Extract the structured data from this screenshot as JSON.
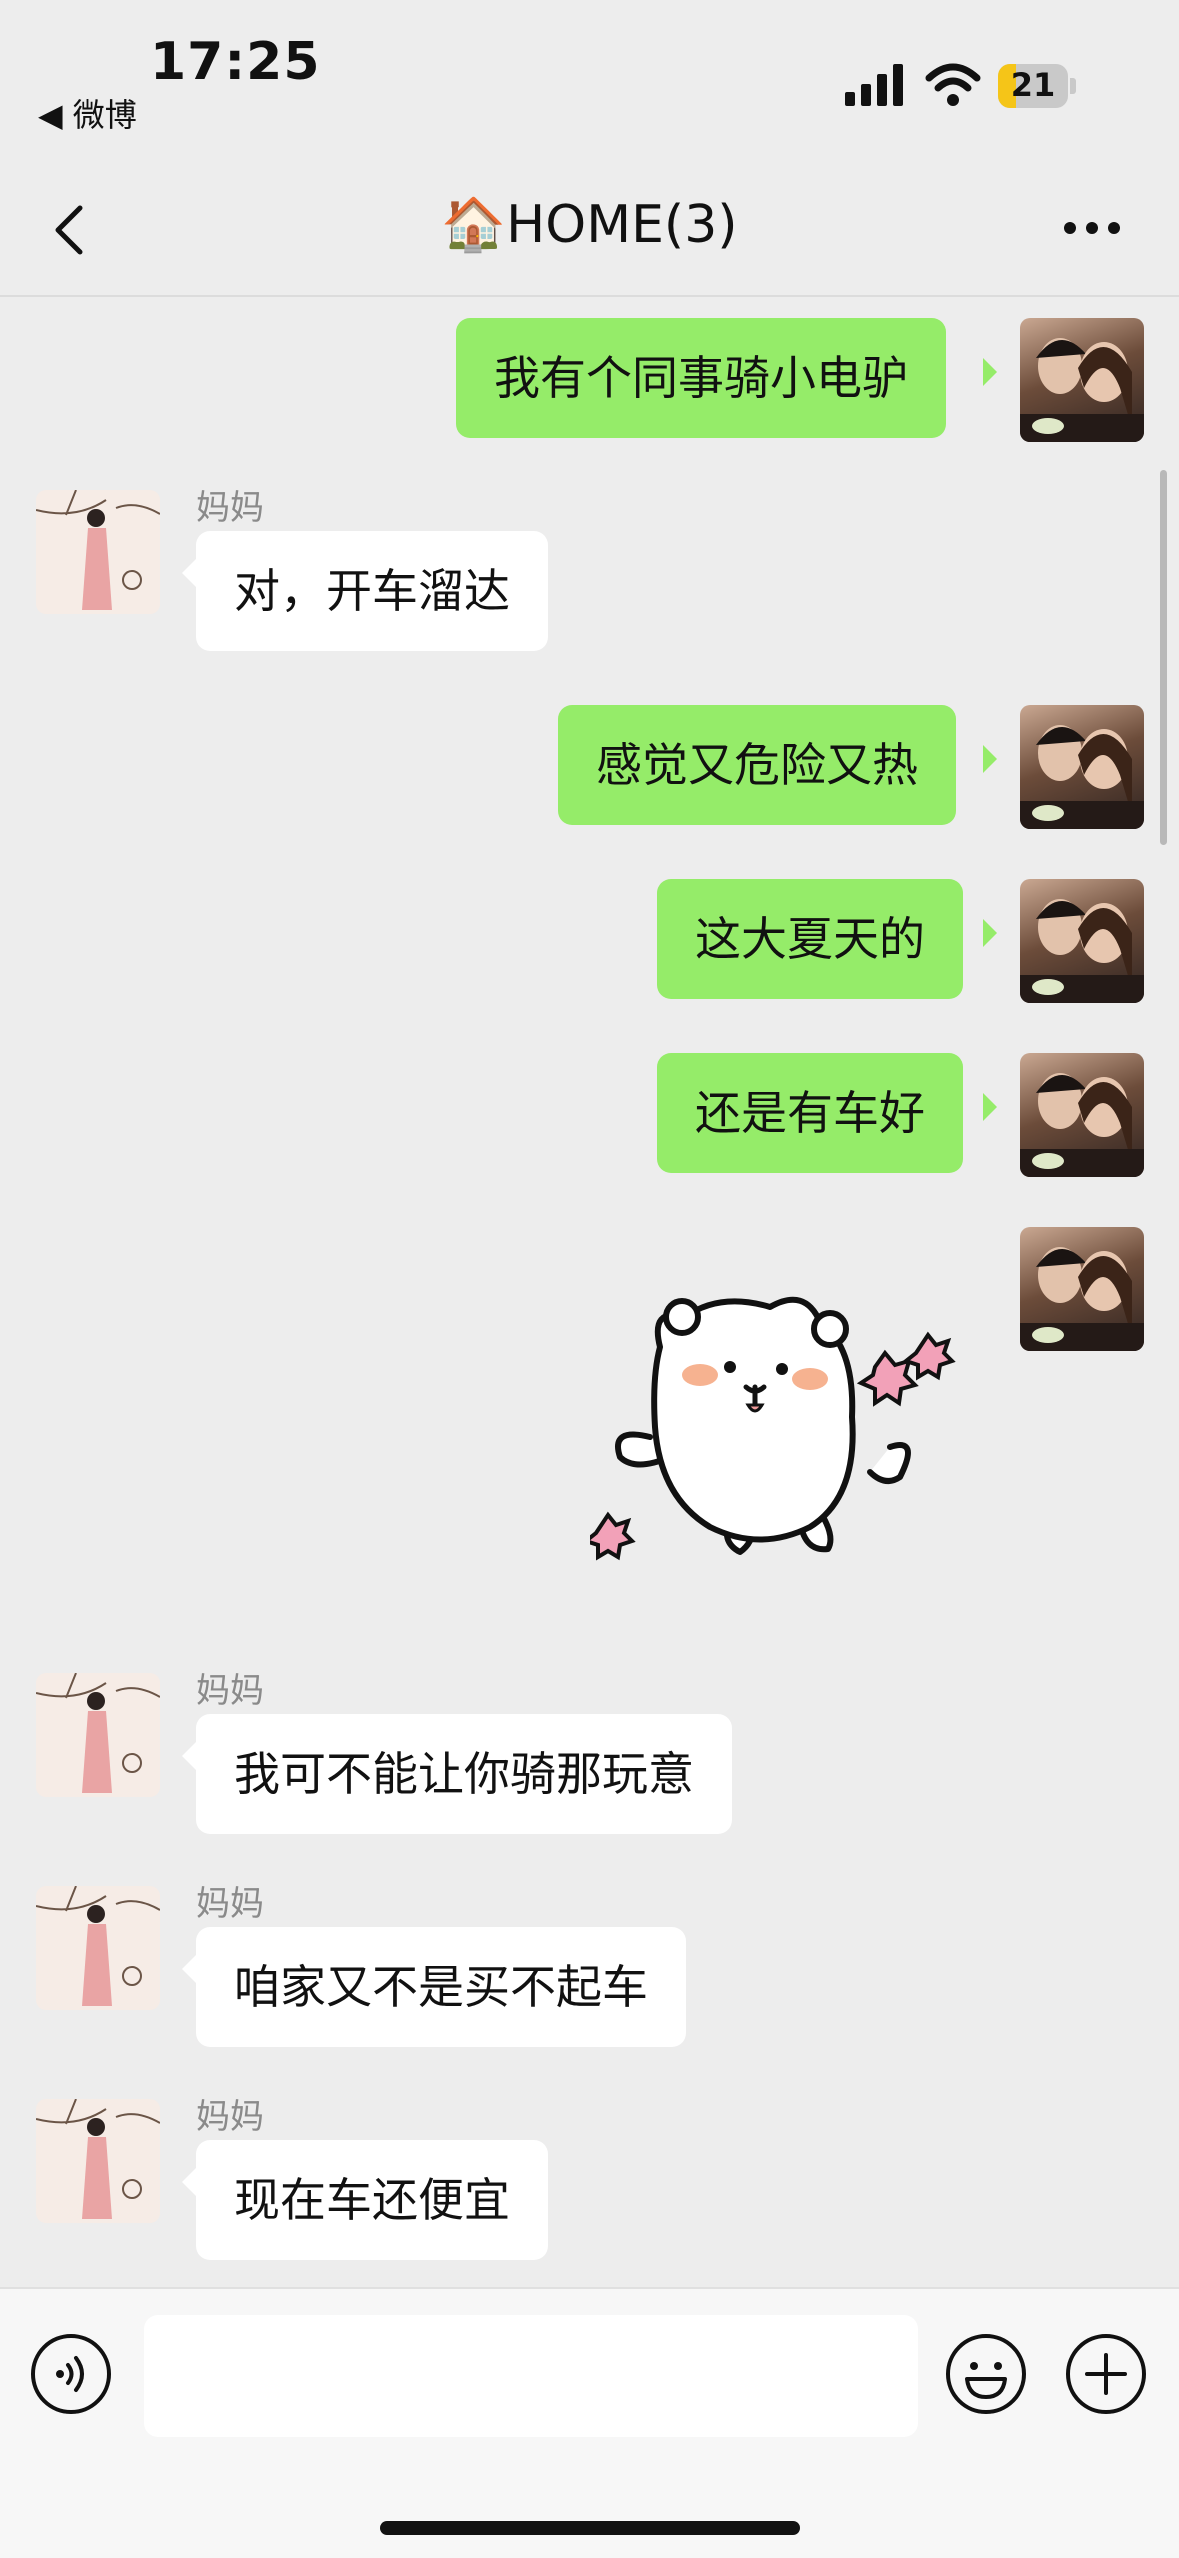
{
  "status_bar": {
    "time": "17:25",
    "back_app": "◀ 微博",
    "battery": "21",
    "battery_color": "#f5c518"
  },
  "nav": {
    "title": "🏠HOME(3)"
  },
  "messages": [
    {
      "from": "me",
      "text": "我有个同事骑小电驴"
    },
    {
      "from": "mom",
      "sender": "妈妈",
      "text": "对，开车溜达"
    },
    {
      "from": "me",
      "text": "感觉又危险又热"
    },
    {
      "from": "me",
      "text": "这大夏天的"
    },
    {
      "from": "me",
      "text": "还是有车好"
    },
    {
      "from": "me",
      "type": "sticker",
      "sticker": "bear-sticker"
    },
    {
      "from": "mom",
      "sender": "妈妈",
      "text": "我可不能让你骑那玩意"
    },
    {
      "from": "mom",
      "sender": "妈妈",
      "text": "咱家又不是买不起车"
    },
    {
      "from": "mom",
      "sender": "妈妈",
      "text": "现在车还便宜"
    }
  ],
  "colors": {
    "bubble_me": "#95ec69",
    "bubble_mom": "#ffffff",
    "background": "#ededed"
  },
  "icons": [
    "chevron-left-icon",
    "more-icon",
    "voice-icon",
    "emoji-icon",
    "plus-icon",
    "signal-icon",
    "wifi-icon"
  ]
}
